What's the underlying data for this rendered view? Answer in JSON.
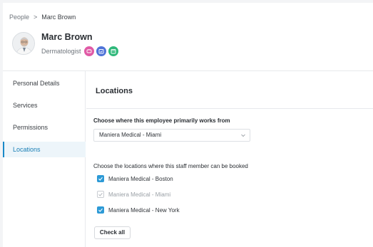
{
  "breadcrumb": {
    "root": "People",
    "separator": ">",
    "current": "Marc Brown"
  },
  "profile": {
    "name": "Marc Brown",
    "role": "Dermatologist",
    "service_icons": [
      {
        "name": "beauty-icon",
        "color": "#e05aa6"
      },
      {
        "name": "calendar-check-icon",
        "color": "#4f73d8"
      },
      {
        "name": "calendar-icon",
        "color": "#2fb87a"
      }
    ]
  },
  "sidebar": {
    "items": [
      {
        "label": "Personal Details",
        "active": false
      },
      {
        "label": "Services",
        "active": false
      },
      {
        "label": "Permissions",
        "active": false
      },
      {
        "label": "Locations",
        "active": true
      }
    ]
  },
  "main": {
    "title": "Locations",
    "primary_question": "Choose where this employee primarily works from",
    "primary_select_value": "Maniera Medical - Miami",
    "booking_question": "Choose the locations where this staff member can be booked",
    "locations": [
      {
        "label": "Maniera Medical - Boston",
        "checked": true,
        "disabled": false
      },
      {
        "label": "Maniera Medical - Miami",
        "checked": true,
        "disabled": true
      },
      {
        "label": "Maniera Medical - New York",
        "checked": true,
        "disabled": false
      }
    ],
    "check_all_label": "Check all"
  },
  "colors": {
    "accent": "#1a89c8",
    "checkbox": "#2d9ad6",
    "active_bg": "#edf5fa"
  }
}
